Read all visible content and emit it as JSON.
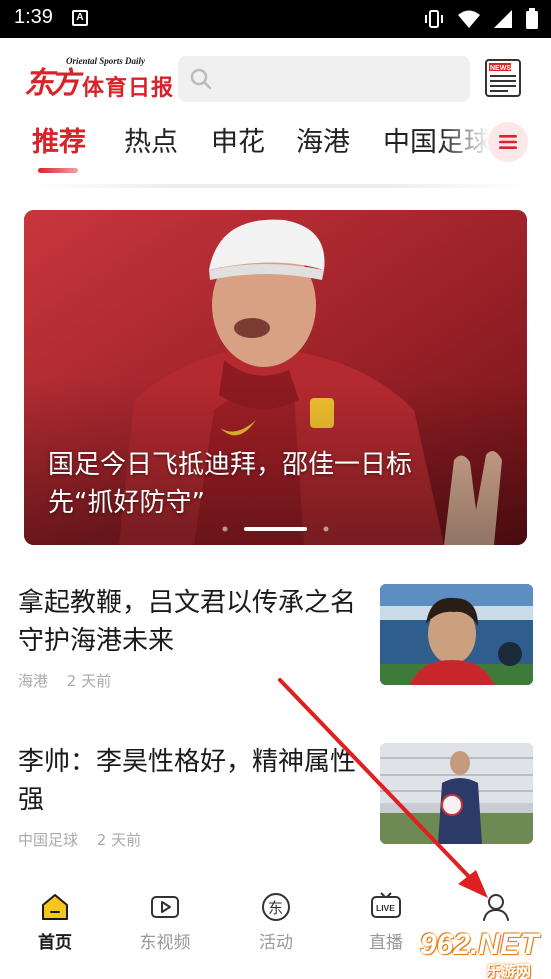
{
  "status_bar": {
    "time": "1:39",
    "notification_glyph": "A"
  },
  "header": {
    "logo_brush": "东方",
    "logo_main": "体育日报",
    "logo_sub": "Oriental Sports Daily",
    "search_placeholder": "",
    "news_icon_text": "NEWS"
  },
  "tabs": [
    {
      "label": "推荐",
      "active": true
    },
    {
      "label": "热点",
      "active": false
    },
    {
      "label": "申花",
      "active": false
    },
    {
      "label": "海港",
      "active": false
    },
    {
      "label": "中国足球",
      "active": false
    }
  ],
  "banner": {
    "caption": "国足今日飞抵迪拜，邵佳一日标先“抓好防守”",
    "dots_count": 3,
    "active_dot": 1
  },
  "news": [
    {
      "title": "拿起教鞭，吕文君以传承之名守护海港未来",
      "tag": "海港",
      "time": "2 天前"
    },
    {
      "title": "李帅：李昊性格好，精神属性强",
      "tag": "中国足球",
      "time": "2 天前"
    }
  ],
  "bottom_nav": [
    {
      "label": "首页",
      "icon": "home-icon",
      "active": true
    },
    {
      "label": "东视频",
      "icon": "video-icon",
      "active": false
    },
    {
      "label": "活动",
      "icon": "activity-icon",
      "active": false
    },
    {
      "label": "直播",
      "icon": "live-icon",
      "active": false
    },
    {
      "label": "",
      "icon": "profile-icon",
      "active": false
    }
  ],
  "watermark": {
    "text": "962.NET",
    "subtext": "乐游网"
  },
  "colors": {
    "brand_red": "#d8232a",
    "annotation_arrow": "#e02020",
    "watermark_orange": "#e87b12"
  }
}
